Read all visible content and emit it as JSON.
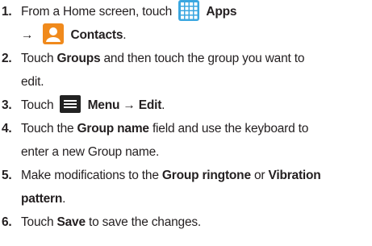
{
  "steps": [
    {
      "num": "1.",
      "line1_pre": "From a Home screen, touch",
      "apps_label": "Apps",
      "apps_icon": "apps-grid-icon",
      "arrow": "→",
      "contacts_label": "Contacts",
      "contacts_icon": "contacts-icon"
    },
    {
      "num": "2.",
      "pre": "Touch",
      "bold1": "Groups",
      "post": "and then touch the group you want to",
      "line2": "edit."
    },
    {
      "num": "3.",
      "pre": "Touch",
      "menu_icon": "menu-icon",
      "menu_label": "Menu",
      "arrow": "→",
      "edit_label": "Edit",
      "end": "."
    },
    {
      "num": "4.",
      "pre": "Touch the",
      "bold1": "Group name",
      "post": "field and use the keyboard to",
      "line2": "enter a new Group name."
    },
    {
      "num": "5.",
      "pre": "Make modifications to the",
      "bold1": "Group ringtone",
      "mid": "or",
      "bold2": "Vibration",
      "line2_bold": "pattern",
      "line2_end": "."
    },
    {
      "num": "6.",
      "pre": "Touch",
      "bold1": "Save",
      "post": "to save the changes."
    }
  ],
  "colors": {
    "text": "#231f20",
    "apps_icon": "#3ba7e0",
    "contacts_icon": "#f08a1c",
    "menu_icon": "#222222"
  }
}
